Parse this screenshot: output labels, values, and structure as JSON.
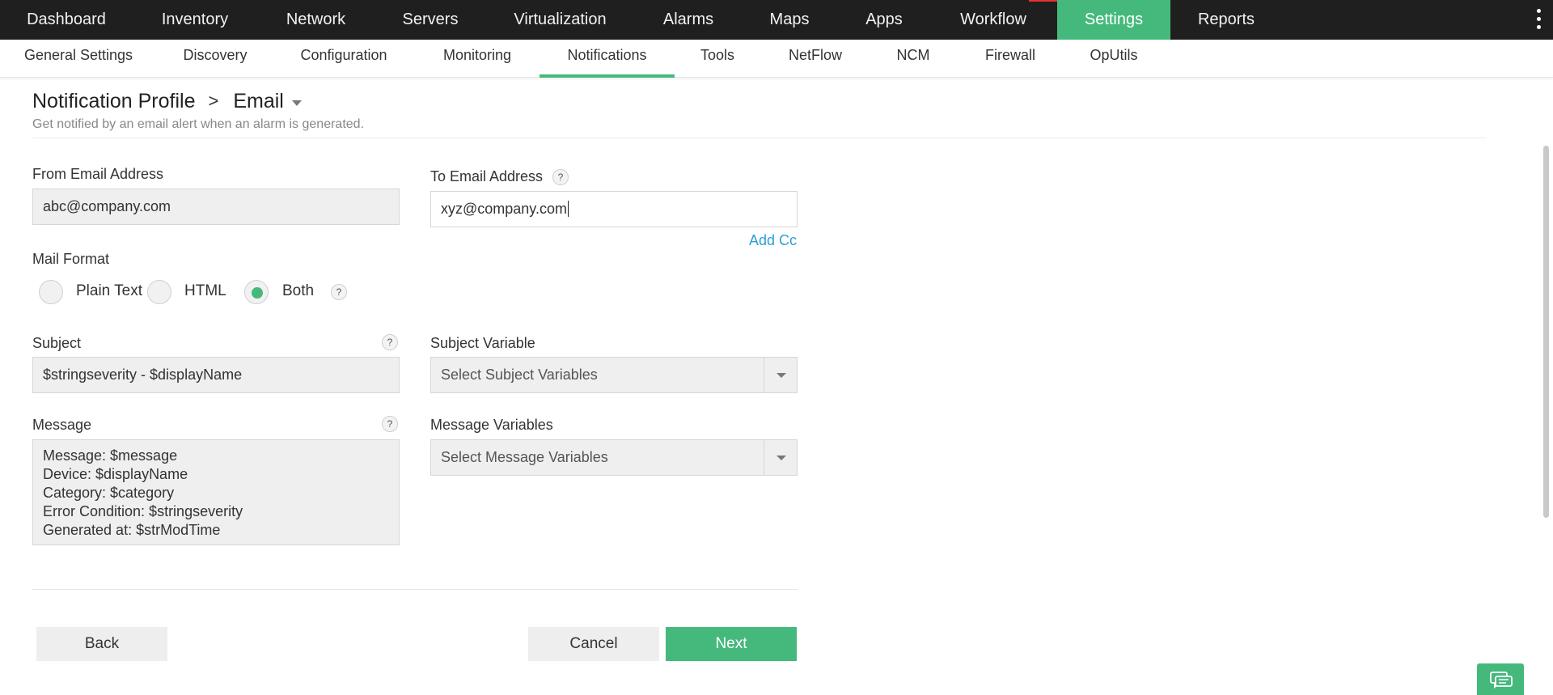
{
  "topnav": {
    "items": [
      "Dashboard",
      "Inventory",
      "Network",
      "Servers",
      "Virtualization",
      "Alarms",
      "Maps",
      "Apps",
      "Workflow",
      "Settings",
      "Reports"
    ],
    "active": "Settings",
    "more_icon": "kebab-menu-icon"
  },
  "subnav": {
    "items": [
      "General Settings",
      "Discovery",
      "Configuration",
      "Monitoring",
      "Notifications",
      "Tools",
      "NetFlow",
      "NCM",
      "Firewall",
      "OpUtils"
    ],
    "active": "Notifications"
  },
  "header": {
    "crumb_parent": "Notification Profile",
    "crumb_separator": ">",
    "crumb_current": "Email",
    "subtitle": "Get notified by an email alert when an alarm is generated."
  },
  "form": {
    "from_label": "From Email Address",
    "from_value": "abc@company.com",
    "to_label": "To Email Address",
    "to_value": "xyz@company.com",
    "add_cc": "Add Cc",
    "help_glyph": "?",
    "mail_format_label": "Mail Format",
    "mail_format_options": [
      "Plain Text",
      "HTML",
      "Both"
    ],
    "mail_format_selected": "Both",
    "subject_label": "Subject",
    "subject_value": "$stringseverity - $displayName",
    "subject_variable_label": "Subject Variable",
    "subject_variable_placeholder": "Select Subject Variables",
    "message_label": "Message",
    "message_lines": [
      "Message: $message",
      "Device: $displayName",
      "Category: $category",
      "Error Condition: $stringseverity",
      "Generated at: $strModTime"
    ],
    "message_variables_label": "Message Variables",
    "message_variables_placeholder": "Select Message Variables"
  },
  "actions": {
    "back": "Back",
    "cancel": "Cancel",
    "next": "Next"
  },
  "colors": {
    "accent": "#45b97c",
    "topnav_bg": "#1f1f1f",
    "link": "#2a9fd8"
  },
  "chat_icon": "chat-icon"
}
